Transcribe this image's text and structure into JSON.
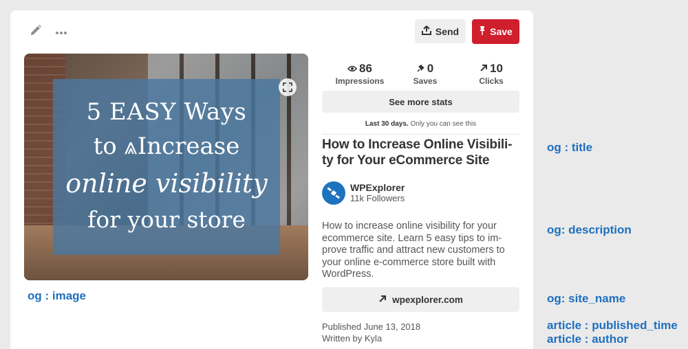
{
  "toolbar": {
    "edit_icon": "pencil-icon",
    "more_icon": "ellipsis-icon",
    "send_label": "Send",
    "save_label": "Save"
  },
  "image": {
    "line1": "5 EASY Ways",
    "line2": "to ⩓Increase",
    "line3": "online visibility",
    "line4": "for your store"
  },
  "stats": {
    "impressions": {
      "value": "86",
      "label": "Impressions"
    },
    "saves": {
      "value": "0",
      "label": "Saves"
    },
    "clicks": {
      "value": "10",
      "label": "Clicks"
    },
    "more_label": "See more stats",
    "note_bold": "Last 30 days.",
    "note_rest": " Only you can see this"
  },
  "pin": {
    "title": "How to Increase Online Visibili-ty for Your eCommerce Site",
    "site_name": "WPExplorer",
    "followers": "11k Followers",
    "description": "How to increase online visibility for your ecommerce site. Learn 5 easy tips to im-prove traffic and attract new customers to your online e-commerce store built with WordPress.",
    "link": "wpexplorer.com",
    "published": "Published June 13, 2018",
    "author": "Written by Kyla"
  },
  "annotations": {
    "image": "og : image",
    "title": "og : title",
    "description": "og: description",
    "site_name": "og: site_name",
    "published_time": "article : published_time",
    "author": "article : author"
  },
  "colors": {
    "save_red": "#cf1e2c",
    "annotation_blue": "#1e6fbf",
    "overlay_blue": "#4a78a0"
  }
}
